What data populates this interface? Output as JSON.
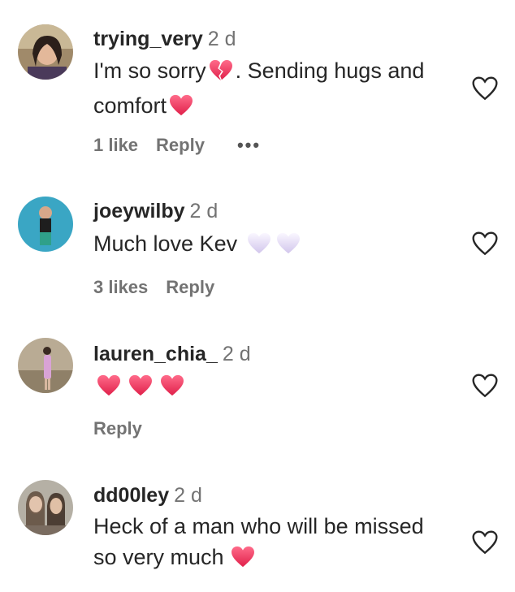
{
  "comments": [
    {
      "username": "trying_very",
      "time": "2 d",
      "text_a": "I'm so sorry",
      "text_b": ". Sending hugs and",
      "text_c": "comfort",
      "likes": "1 like",
      "reply": "Reply",
      "more": "•••"
    },
    {
      "username": "joeywilby",
      "time": "2 d",
      "text_a": "Much love Kev",
      "likes": "3 likes",
      "reply": "Reply"
    },
    {
      "username": "lauren_chia_",
      "time": "2 d",
      "reply": "Reply"
    },
    {
      "username": "dd00ley",
      "time": "2 d",
      "text_a": "Heck of a man who will be missed",
      "text_b": "so very much"
    }
  ],
  "colors": {
    "text": "#262626",
    "muted": "#737373",
    "heart_pink": "#f0325a",
    "heart_white": "#e6dcf5"
  },
  "icons": [
    "broken-heart-icon",
    "pink-heart-icon",
    "white-heart-icon",
    "like-heart-icon",
    "more-icon"
  ]
}
